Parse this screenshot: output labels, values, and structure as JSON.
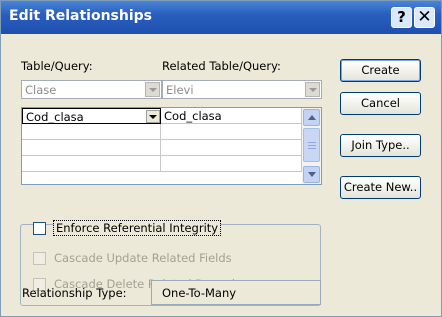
{
  "window": {
    "title": "Edit Relationships",
    "help_glyph": "?",
    "close_glyph": "✕"
  },
  "labels": {
    "table_query": "Table/Query:",
    "related_table_query": "Related Table/Query:"
  },
  "table_combo": {
    "value": "Clase"
  },
  "related_combo": {
    "value": "Elevi"
  },
  "grid": {
    "rows": [
      {
        "left": "Cod_clasa",
        "right": "Cod_clasa"
      },
      {
        "left": "",
        "right": ""
      },
      {
        "left": "",
        "right": ""
      },
      {
        "left": "",
        "right": ""
      }
    ]
  },
  "options": {
    "enforce": "Enforce Referential Integrity",
    "cascade_update": "Cascade Update Related Fields",
    "cascade_delete": "Cascade Delete Related Records"
  },
  "relationship": {
    "label": "Relationship Type:",
    "value": "One-To-Many"
  },
  "buttons": {
    "create": "Create",
    "cancel": "Cancel",
    "join_type": "Join Type..",
    "create_new": "Create New.."
  }
}
